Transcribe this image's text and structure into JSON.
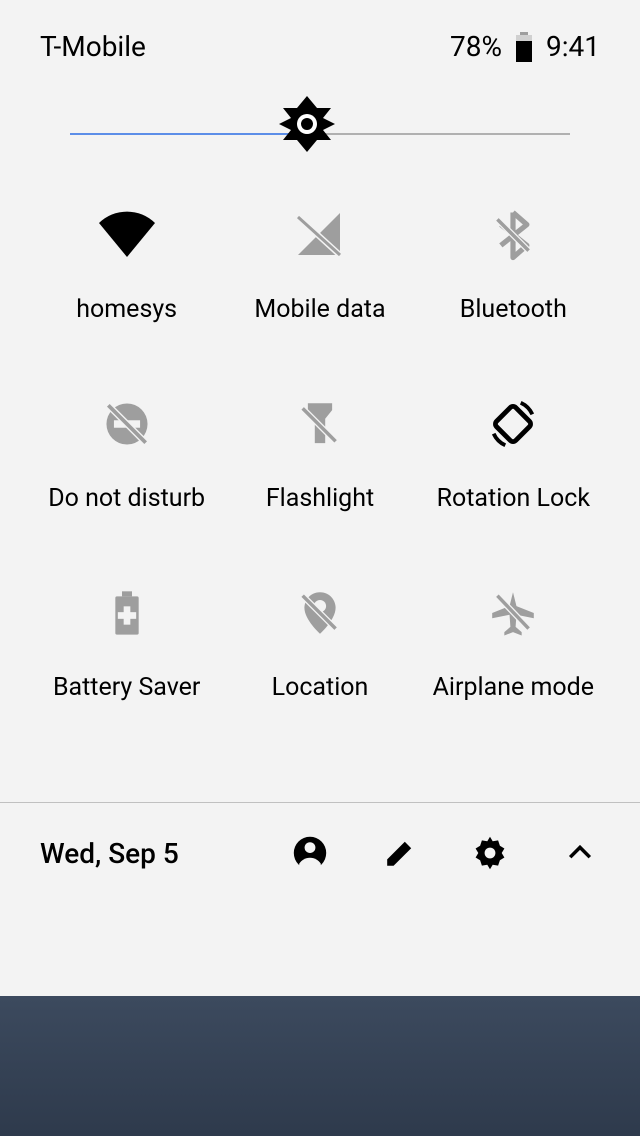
{
  "status": {
    "carrier": "T-Mobile",
    "battery_pct": "78%",
    "time": "9:41"
  },
  "brightness": {
    "value_pct": 48
  },
  "tiles": [
    {
      "label": "homesys",
      "icon": "wifi",
      "active": true
    },
    {
      "label": "Mobile data",
      "icon": "signal-off",
      "active": false
    },
    {
      "label": "Bluetooth",
      "icon": "bluetooth-off",
      "active": false
    },
    {
      "label": "Do not disturb",
      "icon": "dnd-off",
      "active": false
    },
    {
      "label": "Flashlight",
      "icon": "flashlight-off",
      "active": false
    },
    {
      "label": "Rotation Lock",
      "icon": "rotate",
      "active": true
    },
    {
      "label": "Battery Saver",
      "icon": "battery-plus",
      "active": false
    },
    {
      "label": "Location",
      "icon": "location-off",
      "active": false
    },
    {
      "label": "Airplane mode",
      "icon": "airplane-off",
      "active": false
    }
  ],
  "footer": {
    "date": "Wed, Sep 5"
  }
}
